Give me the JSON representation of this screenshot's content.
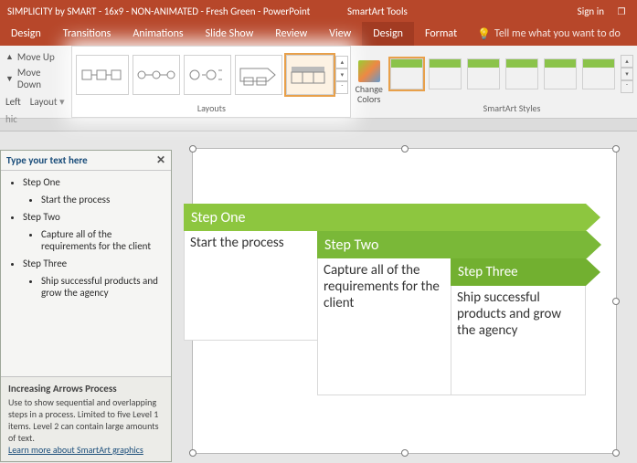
{
  "titlebar": {
    "title": "SIMPLICITY by SMART - 16x9 - NON-ANIMATED - Fresh Green - PowerPoint",
    "context_tab": "SmartArt Tools",
    "signin": "Sign in"
  },
  "tabs": {
    "design": "Design",
    "transitions": "Transitions",
    "animations": "Animations",
    "slideshow": "Slide Show",
    "review": "Review",
    "view": "View",
    "sa_design": "Design",
    "format": "Format",
    "tellme": "Tell me what you want to do"
  },
  "reorder": {
    "moveup": "Move Up",
    "movedown": "Move Down",
    "left": "Left",
    "layout": "Layout",
    "hic": "hic"
  },
  "groups": {
    "layouts": "Layouts",
    "change_colors": "Change Colors",
    "styles": "SmartArt Styles"
  },
  "textpane": {
    "header": "Type your text here",
    "items": [
      {
        "title": "Step One",
        "sub": "Start the process"
      },
      {
        "title": "Step Two",
        "sub": "Capture all of the requirements for the client"
      },
      {
        "title": "Step Three",
        "sub": "Ship successful products and grow the agency"
      }
    ],
    "info_title": "Increasing Arrows Process",
    "info_body": "Use to show sequential and overlapping steps in a process. Limited to five Level 1 items. Level 2 can contain large amounts of text.",
    "info_link": "Learn more about SmartArt graphics"
  },
  "smartart": {
    "step1_title": "Step One",
    "step1_desc": "Start the process",
    "step2_title": "Step Two",
    "step2_desc": "Capture all of the requirements for the client",
    "step3_title": "Step Three",
    "step3_desc": "Ship successful products and grow the agency"
  }
}
